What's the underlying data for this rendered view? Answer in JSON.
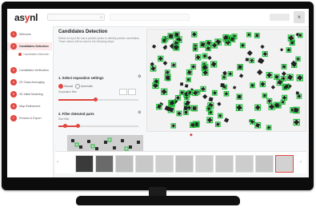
{
  "app": {
    "logo_prefix": "as",
    "logo_dot": "y",
    "logo_suffix": "nl",
    "search_placeholder": "Search",
    "close_symbol": "×"
  },
  "sidebar": {
    "steps": [
      {
        "num": "1",
        "label": "Welcome"
      },
      {
        "num": "2",
        "label": "Candidates Detection",
        "active": true
      },
      {
        "num": "3",
        "label": "Candidates Verification"
      },
      {
        "num": "4",
        "label": "2D Class Averaging"
      },
      {
        "num": "5",
        "label": "3D Initial Modeling"
      },
      {
        "num": "6",
        "label": "Map Refinement"
      },
      {
        "num": "7",
        "label": "Preview & Export"
      }
    ],
    "substep": "Candidates Detection"
  },
  "panel": {
    "title": "Candidates Detection",
    "description": "Select an input file and a particle picker to identify particle candidates. These values will be used in the following steps.",
    "section1_title": "1. Select separation settings",
    "radio_a": "Manual",
    "radio_b": "Automatic",
    "field1_label": "Separation filter",
    "section2_title": "2. Filter detected parts",
    "field2_label": "Size filter"
  },
  "viewer": {
    "accent_color": "#1fbf3a",
    "particle_color": "#222222"
  },
  "colors": {
    "accent": "#e0473f",
    "selection": "#1fbf3a"
  }
}
